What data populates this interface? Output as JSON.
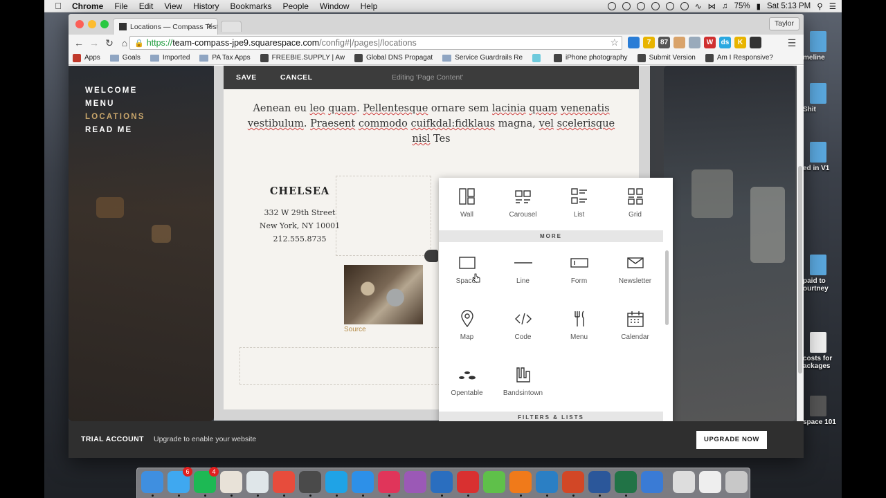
{
  "menubar": {
    "app": "Chrome",
    "menus": [
      "File",
      "Edit",
      "View",
      "History",
      "Bookmarks",
      "People",
      "Window",
      "Help"
    ],
    "battery": "75%",
    "clock": "Sat 5:13 PM"
  },
  "desktop_files": [
    {
      "label": "meline"
    },
    {
      "label": "Shit"
    },
    {
      "label": "ed in V1"
    },
    {
      "label": "paid to\nourtney"
    },
    {
      "label": "costs for\nackages"
    },
    {
      "label": "space 101"
    }
  ],
  "browser": {
    "tab_title": "Locations — Compass Test",
    "profile": "Taylor",
    "url_scheme": "https://",
    "url_host": "team-compass-jpe9.squarespace.com",
    "url_path": "/config#|/pages|/locations",
    "extensions": [
      {
        "icon": "download-icon",
        "color": "#2a7dd6",
        "text": ""
      },
      {
        "icon": "sunny-icon",
        "color": "#e8b400",
        "text": "7"
      },
      {
        "icon": "calendar-87-icon",
        "color": "#555555",
        "text": "87"
      },
      {
        "icon": "face-icon",
        "color": "#d9a36a",
        "text": ""
      },
      {
        "icon": "camera-icon",
        "color": "#9ab",
        "text": ""
      },
      {
        "icon": "w-icon",
        "color": "#d03030",
        "text": "W"
      },
      {
        "icon": "ds-icon",
        "color": "#2aa8e0",
        "text": "ds"
      },
      {
        "icon": "k-icon",
        "color": "#e8b400",
        "text": "K"
      },
      {
        "icon": "eyedropper-icon",
        "color": "#333",
        "text": ""
      }
    ],
    "bookmarks": [
      {
        "label": "Apps",
        "icon": "apps-icon"
      },
      {
        "label": "Goals",
        "icon": "folder-icon"
      },
      {
        "label": "Imported",
        "icon": "folder-icon"
      },
      {
        "label": "PA Tax Apps",
        "icon": "folder-icon"
      },
      {
        "label": "FREEBIE.SUPPLY | Aw",
        "icon": "favicon"
      },
      {
        "label": "Global DNS Propagat",
        "icon": "favicon"
      },
      {
        "label": "Service Guardrails Re",
        "icon": "folder-icon"
      },
      {
        "label": "",
        "icon": "slack-icon"
      },
      {
        "label": "iPhone photography",
        "icon": "favicon"
      },
      {
        "label": "Submit Version",
        "icon": "favicon"
      },
      {
        "label": "Am I Responsive?",
        "icon": "favicon"
      }
    ]
  },
  "site": {
    "nav": [
      "WELCOME",
      "MENU",
      "LOCATIONS",
      "READ ME"
    ],
    "active_nav": "LOCATIONS"
  },
  "editor": {
    "save": "SAVE",
    "cancel": "CANCEL",
    "status": "Editing 'Page Content'",
    "paragraph": [
      {
        "t": "Aenean",
        "u": false
      },
      {
        "t": " eu ",
        "u": false
      },
      {
        "t": "leo",
        "u": true
      },
      {
        "t": " ",
        "u": false
      },
      {
        "t": "quam",
        "u": true
      },
      {
        "t": ". ",
        "u": false
      },
      {
        "t": "Pellentesque",
        "u": true
      },
      {
        "t": " ornare sem ",
        "u": false
      },
      {
        "t": "lacinia",
        "u": true
      },
      {
        "t": " ",
        "u": false
      },
      {
        "t": "quam",
        "u": true
      },
      {
        "t": " ",
        "u": false
      },
      {
        "t": "venenatis",
        "u": true
      },
      {
        "t": " ",
        "u": false
      },
      {
        "t": "vestibulum",
        "u": true
      },
      {
        "t": ". ",
        "u": false
      },
      {
        "t": "Praesent",
        "u": true
      },
      {
        "t": " ",
        "u": false
      },
      {
        "t": "commodo",
        "u": true
      },
      {
        "t": " ",
        "u": false
      },
      {
        "t": "cuifkdal:fidklaus",
        "u": true
      },
      {
        "t": " magna, ",
        "u": false
      },
      {
        "t": "vel",
        "u": true
      },
      {
        "t": " ",
        "u": false
      },
      {
        "t": "scelerisque",
        "u": true
      },
      {
        "t": " ",
        "u": false
      },
      {
        "t": "nisl",
        "u": true
      },
      {
        "t": " Tes",
        "u": false
      }
    ],
    "location": {
      "name": "CHELSEA",
      "street": "332 W 29th Street",
      "city": "New York, NY 10001",
      "phone": "212.555.8735"
    },
    "image_caption": "Source"
  },
  "block_picker": {
    "row1": [
      {
        "label": "Wall",
        "icon": "wall-icon"
      },
      {
        "label": "Carousel",
        "icon": "carousel-icon"
      },
      {
        "label": "List",
        "icon": "list-icon"
      },
      {
        "label": "Grid",
        "icon": "grid-icon"
      }
    ],
    "more_header": "MORE",
    "row2": [
      {
        "label": "Spacer",
        "icon": "spacer-icon"
      },
      {
        "label": "Line",
        "icon": "line-icon"
      },
      {
        "label": "Form",
        "icon": "form-icon"
      },
      {
        "label": "Newsletter",
        "icon": "newsletter-icon"
      }
    ],
    "row3": [
      {
        "label": "Map",
        "icon": "map-pin-icon"
      },
      {
        "label": "Code",
        "icon": "code-icon"
      },
      {
        "label": "Menu",
        "icon": "fork-knife-icon"
      },
      {
        "label": "Calendar",
        "icon": "calendar-icon"
      }
    ],
    "row4": [
      {
        "label": "Opentable",
        "icon": "opentable-icon"
      },
      {
        "label": "Bandsintown",
        "icon": "bandsintown-icon"
      }
    ],
    "filters_header": "FILTERS & LISTS"
  },
  "trial": {
    "title": "TRIAL ACCOUNT",
    "message": "Upgrade to enable your website",
    "button": "UPGRADE NOW"
  },
  "dock": [
    {
      "name": "finder-icon",
      "color": "#3f8fe0",
      "badge": ""
    },
    {
      "name": "messages-icon",
      "color": "#3fa8f0",
      "badge": "6"
    },
    {
      "name": "spotify-icon",
      "color": "#1db954",
      "badge": "4"
    },
    {
      "name": "slack-icon",
      "color": "#e8e2d8",
      "badge": ""
    },
    {
      "name": "atom-icon",
      "color": "#dfe6e9",
      "badge": ""
    },
    {
      "name": "chrome-icon",
      "color": "#e74c3c",
      "badge": ""
    },
    {
      "name": "sublime-icon",
      "color": "#4a4a4a",
      "badge": ""
    },
    {
      "name": "skype-icon",
      "color": "#1fa3e6",
      "badge": ""
    },
    {
      "name": "safari-icon",
      "color": "#2d90e8",
      "badge": ""
    },
    {
      "name": "airmail-icon",
      "color": "#e0355a",
      "badge": ""
    },
    {
      "name": "color-picker-icon",
      "color": "#9b59b6",
      "badge": ""
    },
    {
      "name": "1password-icon",
      "color": "#2a6ebf",
      "badge": ""
    },
    {
      "name": "reeder-icon",
      "color": "#d93030",
      "badge": ""
    },
    {
      "name": "evernote-icon",
      "color": "#5fc04a",
      "badge": ""
    },
    {
      "name": "firefox-icon",
      "color": "#f07a1a",
      "badge": ""
    },
    {
      "name": "xcode-icon",
      "color": "#2b7fc4",
      "badge": ""
    },
    {
      "name": "powerpoint-icon",
      "color": "#d24726",
      "badge": ""
    },
    {
      "name": "word-icon",
      "color": "#2b579a",
      "badge": ""
    },
    {
      "name": "excel-icon",
      "color": "#217346",
      "badge": ""
    },
    {
      "name": "quicktime-icon",
      "color": "#3a7bd5",
      "badge": ""
    },
    {
      "name": "preview-icon",
      "color": "#dddddd",
      "badge": ""
    },
    {
      "name": "chrome-doc-icon",
      "color": "#eeeeee",
      "badge": ""
    },
    {
      "name": "trash-icon",
      "color": "#c8c8c8",
      "badge": ""
    }
  ]
}
